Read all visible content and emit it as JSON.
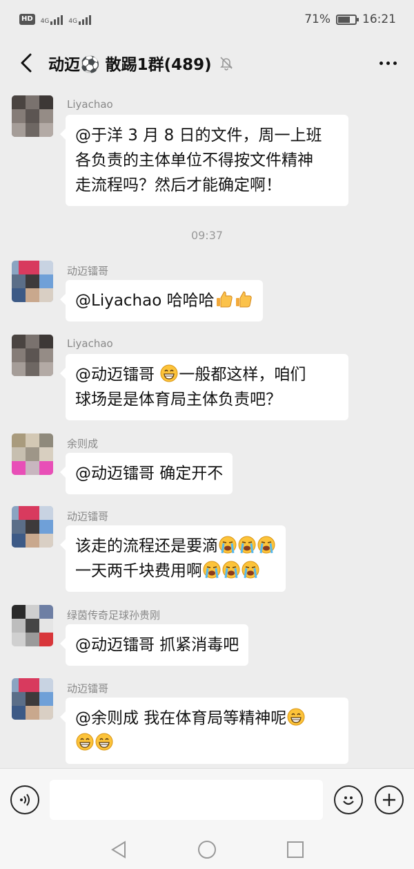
{
  "status_bar": {
    "hd": "HD",
    "sim1": "4G",
    "sim2": "4G",
    "battery_pct": "71%",
    "battery_level": 0.71,
    "time": "16:21"
  },
  "header": {
    "title": "动迈⚽️ 散踢1群(489)",
    "muted": true
  },
  "messages": [
    {
      "sender": "Liyachao",
      "lines": [
        "@于洋  3 月 8 日的文件，周一上班",
        "各负责的主体单位不得按文件精神",
        "走流程吗？然后才能确定啊！"
      ]
    },
    {
      "timestamp": "09:37"
    },
    {
      "sender": "动迈镭哥",
      "lines": [
        "@Liyachao  哈哈哈"
      ]
    },
    {
      "sender": "Liyachao",
      "lines": [
        "@动迈镭哥",
        "一般都这样，咱们",
        "球场是是体育局主体负责吧？"
      ]
    },
    {
      "sender": "余则成",
      "lines": [
        "@动迈镭哥  确定开不"
      ]
    },
    {
      "sender": "动迈镭哥",
      "lines": [
        "该走的流程还是要滴",
        "一天两千块费用啊"
      ]
    },
    {
      "sender": "绿茵传奇足球孙贵刚",
      "lines": [
        "@动迈镭哥  抓紧消毒吧"
      ]
    },
    {
      "sender": "动迈镭哥",
      "lines": [
        "@余则成  我在体育局等精神呢"
      ]
    }
  ],
  "icons": {
    "back": "back-arrow-icon",
    "mute": "bell-off-icon",
    "more": "more-dots-icon",
    "voice": "voice-icon",
    "emoji": "smile-icon",
    "plus": "plus-icon",
    "thumbs": "thumbs-up-emoji",
    "grin": "grin-emoji",
    "cry": "loudly-crying-emoji"
  },
  "input": {
    "value": ""
  },
  "colors": {
    "background": "#ededed",
    "bubble": "#ffffff",
    "sender": "#888888"
  }
}
